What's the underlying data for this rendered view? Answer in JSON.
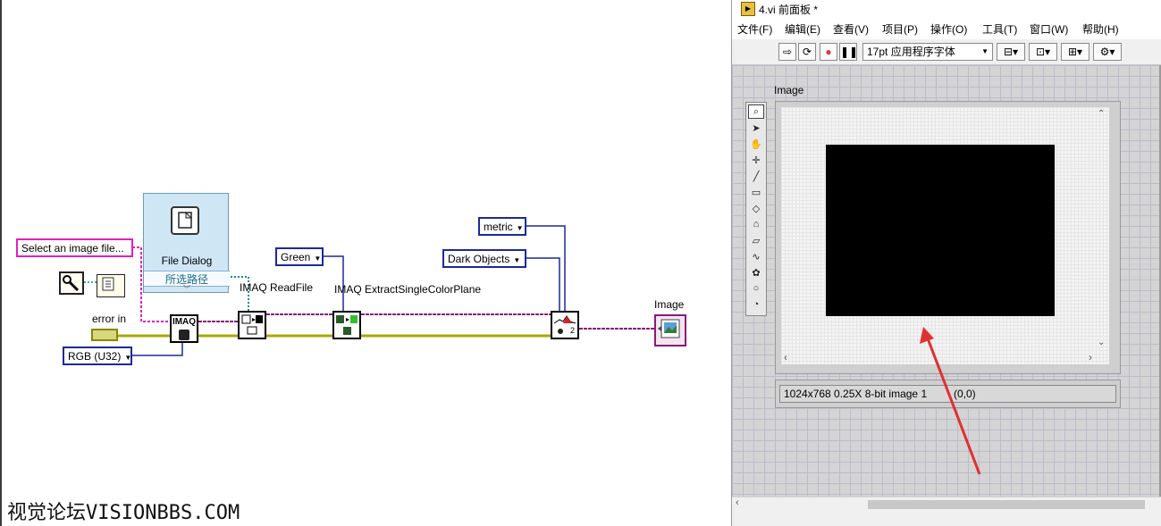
{
  "diagram": {
    "file_dialog": {
      "title": "File Dialog",
      "selected_path": "所选路径"
    },
    "prompt_constant": "Select an image file...",
    "error_in_label": "error in",
    "imaq_label": "IMAQ",
    "image_type_constant": "RGB (U32)",
    "color_plane_constant": "Green",
    "units_constant": "metric",
    "object_type_constant": "Dark Objects",
    "read_file_label": "IMAQ ReadFile",
    "extract_label": "IMAQ ExtractSingleColorPlane",
    "image_indicator_label": "Image",
    "threshold_node_badge": "2",
    "colors": {
      "image_wire": "#8a1a7a",
      "error_wire": "#a8a800",
      "path_wire": "#1a8a8a",
      "string_wire": "#e020c0",
      "enum_wire": "#1a2a9a"
    }
  },
  "watermark": "视觉论坛VISIONBBS.COM",
  "window": {
    "title": "4.vi 前面板 *",
    "menus": [
      "文件(F)",
      "编辑(E)",
      "查看(V)",
      "项目(P)",
      "操作(O)",
      "工具(T)",
      "窗口(W)",
      "帮助(H)"
    ],
    "font_selector": "17pt 应用程序字体",
    "image_label": "Image",
    "status_text": "1024x768 0.25X 8-bit image 1",
    "coords_text": "(0,0)",
    "tools": [
      "zoom-icon",
      "pointer-icon",
      "pan-icon",
      "point-icon",
      "line-icon",
      "rectangle-icon",
      "rotated-rectangle-icon",
      "polygon-icon",
      "polygon-outline-icon",
      "freehand-icon",
      "freehand-region-icon",
      "oval-icon",
      "annulus-icon"
    ],
    "arrow_color": "#e03030"
  }
}
